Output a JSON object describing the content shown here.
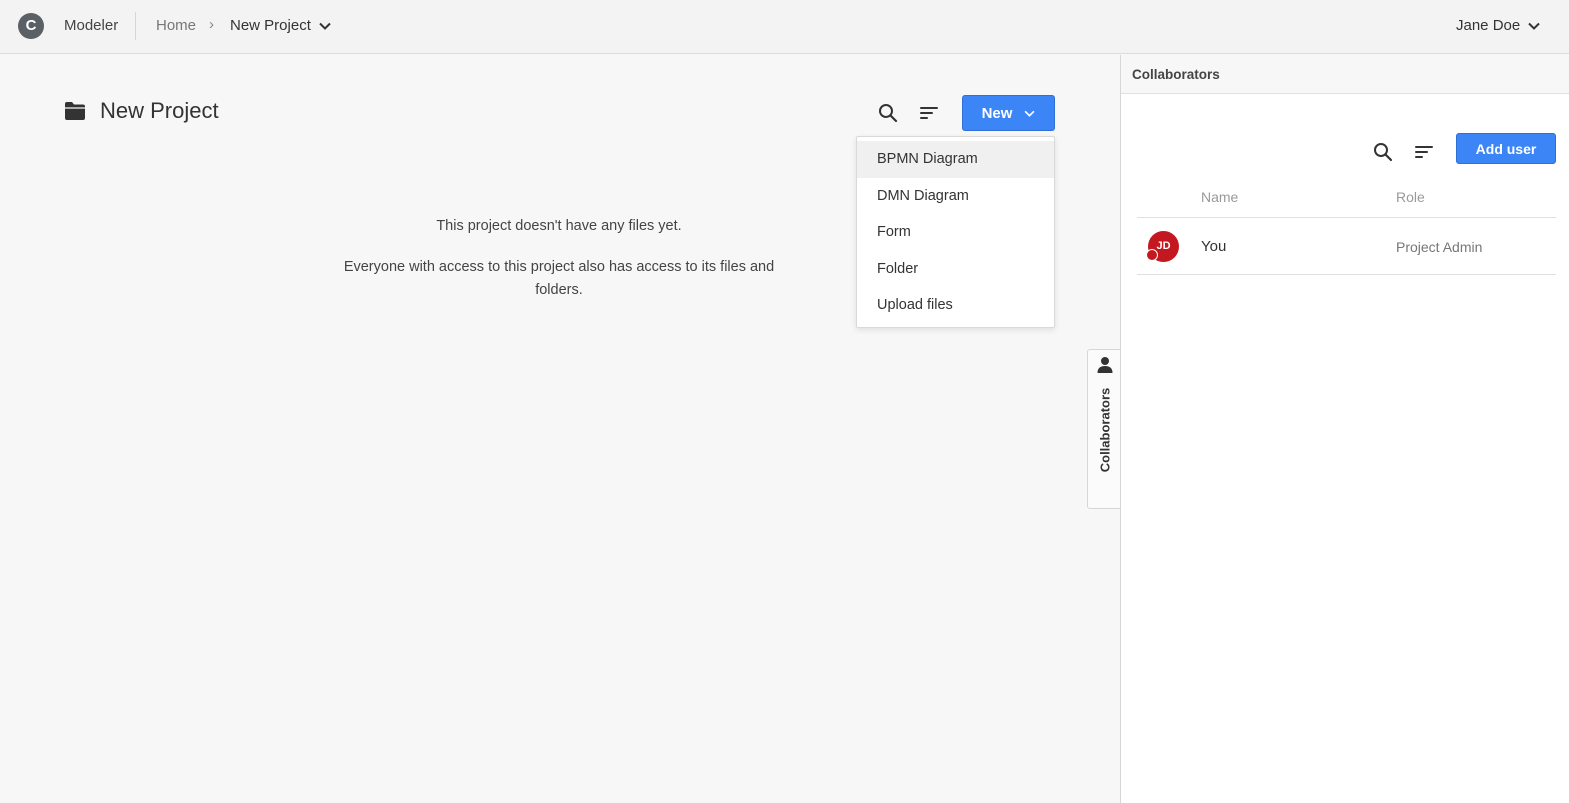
{
  "topbar": {
    "logo_letter": "C",
    "app_name": "Modeler",
    "breadcrumb": {
      "home": "Home",
      "separator": "›",
      "current": "New Project"
    },
    "user": "Jane Doe"
  },
  "project": {
    "title": "New Project",
    "new_button_label": "New"
  },
  "new_menu": {
    "items": [
      "BPMN Diagram",
      "DMN Diagram",
      "Form",
      "Folder",
      "Upload files"
    ],
    "highlighted": "BPMN Diagram"
  },
  "empty_state": {
    "line1": "This project doesn't have any files yet.",
    "line2": "Everyone with access to this project also has access to its files and folders."
  },
  "side_tab": {
    "label": "Collaborators",
    "icon": "person-icon"
  },
  "collaborators_panel": {
    "title": "Collaborators",
    "add_user_label": "Add user",
    "columns": {
      "name": "Name",
      "role": "Role"
    },
    "rows": [
      {
        "initials": "JD",
        "name": "You",
        "role": "Project Admin"
      }
    ]
  },
  "colors": {
    "primary": "#3c85f7",
    "avatar": "#c3181f",
    "topbar_bg": "#f3f3f3"
  }
}
